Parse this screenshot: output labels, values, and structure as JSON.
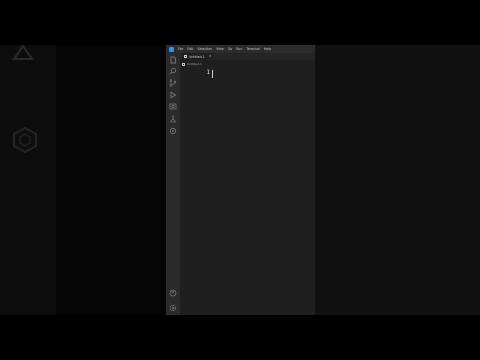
{
  "window": {
    "menubar": {
      "items": [
        {
          "label": "File"
        },
        {
          "label": "Edit"
        },
        {
          "label": "Selection"
        },
        {
          "label": "View"
        },
        {
          "label": "Go"
        },
        {
          "label": "Run"
        },
        {
          "label": "Terminal"
        },
        {
          "label": "Help"
        }
      ]
    },
    "activity_bar": {
      "icons": [
        "explorer-icon",
        "search-icon",
        "source-control-icon",
        "run-debug-icon",
        "remote-explorer-icon",
        "testing-icon",
        "extensions-icon",
        "account-icon",
        "settings-gear-icon"
      ]
    },
    "editor": {
      "tab": {
        "label": "Untitled-1",
        "close": "×"
      },
      "breadcrumb": {
        "label": "Untitled-1"
      },
      "line_number": "1"
    }
  },
  "colors": {
    "editor_bg": "#1f1f1f",
    "activity_bar_bg": "#2b2b2b",
    "menubar_bg": "#2c2c2c",
    "accent": "#3b8eea"
  }
}
